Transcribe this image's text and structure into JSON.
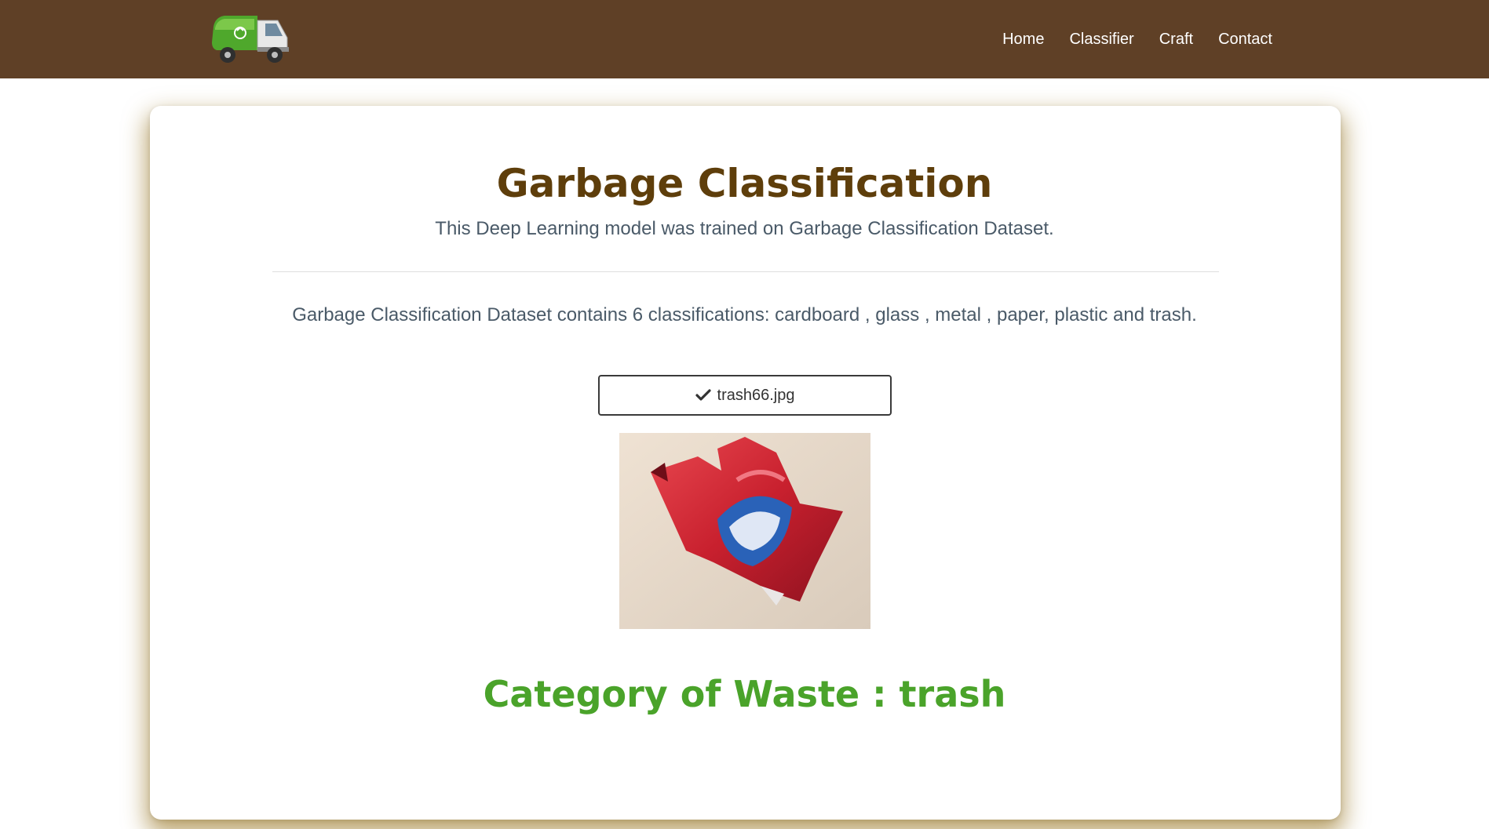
{
  "nav": {
    "logo_icon": "garbage-truck-icon",
    "links": [
      "Home",
      "Classifier",
      "Craft",
      "Contact"
    ]
  },
  "main": {
    "title": "Garbage Classification",
    "subtitle": "This Deep Learning model was trained on Garbage Classification Dataset.",
    "description": "Garbage Classification Dataset contains 6 classifications: cardboard , glass , metal , paper, plastic and trash.",
    "file_name": "trash66.jpg",
    "file_icon": "checkmark-icon",
    "result": "Category of Waste : trash"
  },
  "colors": {
    "navbar": "#5f4026",
    "title": "#5e3e0b",
    "result": "#4aa32a"
  }
}
